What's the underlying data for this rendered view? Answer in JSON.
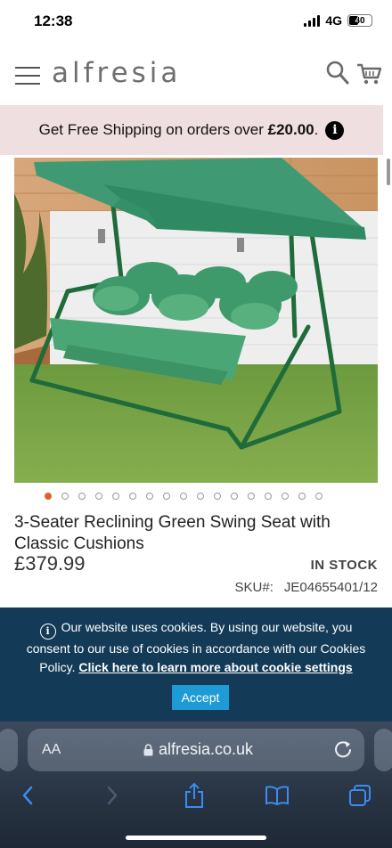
{
  "status_bar": {
    "time": "12:38",
    "network": "4G",
    "battery": "40",
    "battery_level": 0.4
  },
  "header": {
    "logo": "alfresia"
  },
  "banner": {
    "text": "Get Free Shipping on orders over ",
    "amount": "£20.00",
    "suffix": "."
  },
  "product": {
    "title": "3-Seater Reclining Green Swing Seat with Classic Cushions",
    "price": "£379.99",
    "stock": "IN STOCK",
    "sku_label": "SKU#:",
    "sku_value": "JE04655401/12",
    "gallery_count": 17,
    "gallery_active": 1
  },
  "cookie": {
    "text": "Our website uses cookies. By using our website, you consent to our use of cookies in accordance with our Cookies Policy. ",
    "link": "Click here to learn more about cookie settings",
    "accept": "Accept"
  },
  "browser": {
    "aa": "AA",
    "url": "alfresia.co.uk"
  },
  "colors": {
    "banner_bg": "#f0dfe0",
    "cookie_bg": "#133a57",
    "accept_bg": "#1e9ad6",
    "active_dot": "#e0612b",
    "safari_icon": "#3b8bf2"
  },
  "icons": [
    "hamburger-icon",
    "search-icon",
    "cart-icon",
    "info-icon",
    "lock-icon",
    "reload-icon",
    "back-icon",
    "forward-icon",
    "share-icon",
    "bookmarks-icon",
    "tabs-icon"
  ]
}
